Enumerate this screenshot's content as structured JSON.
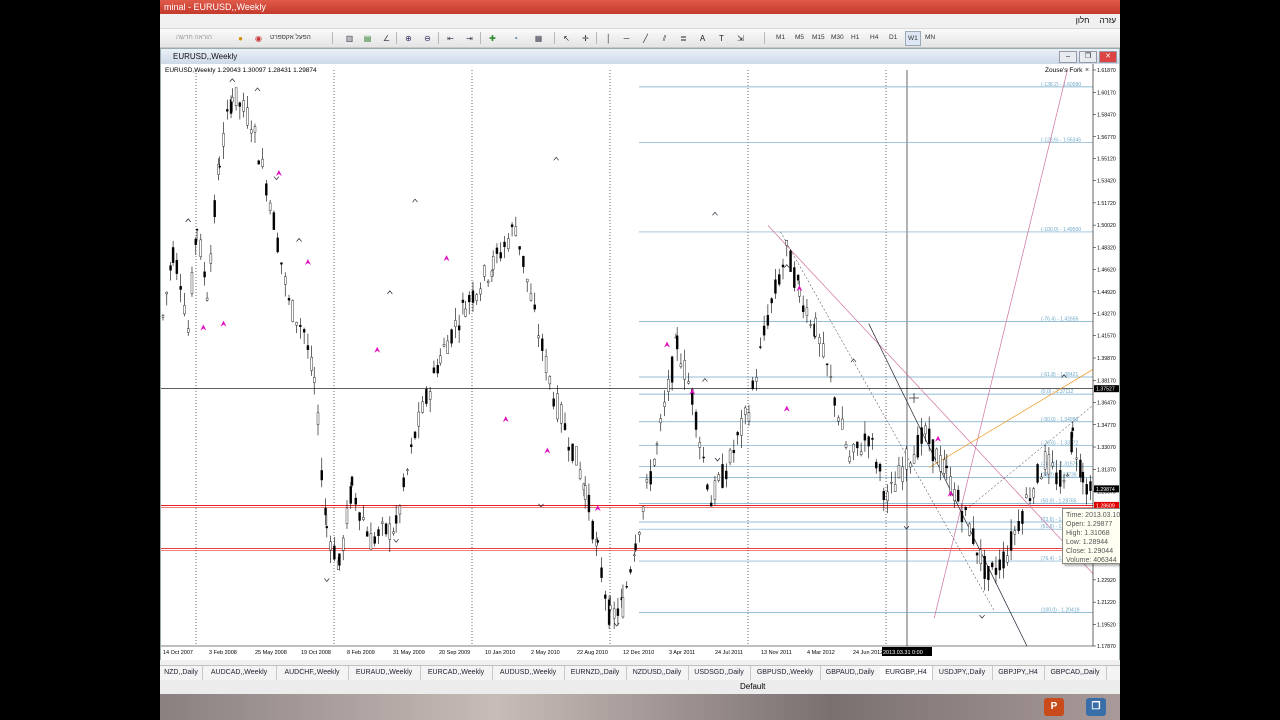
{
  "window": {
    "title": "minal - EURUSD,,Weekly"
  },
  "menu": {
    "items": [
      "עזרה",
      "חלון"
    ]
  },
  "toolbar": {
    "new_order": "הוראה חדשה",
    "expert_advisor": "הפעל אקספרט",
    "timeframes": [
      "M1",
      "M5",
      "M15",
      "M30",
      "H1",
      "H4",
      "D1",
      "W1",
      "MN"
    ],
    "active_timeframe": "W1"
  },
  "chart_window": {
    "title": "EURUSD,,Weekly"
  },
  "chart_data": {
    "type": "candlestick",
    "symbol": "EURUSD,,Weekly",
    "ohlc_header": "EURUSD,Weekly  1.29043 1.30097 1.28431 1.29874",
    "indicator_label": "Zouse's Fork",
    "y_ticks": [
      "1.61870",
      "1.60170",
      "1.58470",
      "1.56770",
      "1.55120",
      "1.53420",
      "1.51720",
      "1.50020",
      "1.48320",
      "1.46620",
      "1.44920",
      "1.43270",
      "1.41570",
      "1.39870",
      "1.38170",
      "1.36470",
      "1.34770",
      "1.33070",
      "1.31370",
      "1.29670",
      "1.28020",
      "1.26320",
      "1.24620",
      "1.22920",
      "1.21220",
      "1.19520",
      "1.17870"
    ],
    "ylim": [
      1.1787,
      1.6187
    ],
    "x_ticks": [
      "14 Oct 2007",
      "3 Feb 2008",
      "25 May 2008",
      "19 Oct 2008",
      "8 Feb 2009",
      "31 May 2009",
      "20 Sep 2009",
      "10 Jan 2010",
      "2 May 2010",
      "22 Aug 2010",
      "12 Dec 2010",
      "3 Apr 2011",
      "24 Jul 2011",
      "13 Nov 2011",
      "4 Mar 2012",
      "24 Jun 2012",
      "14 Oct 2012",
      "2013.03.31 0:00"
    ],
    "price_path": [
      [
        0,
        1.43
      ],
      [
        8,
        1.48
      ],
      [
        14,
        1.46
      ],
      [
        20,
        1.42
      ],
      [
        27,
        1.5
      ],
      [
        35,
        1.45
      ],
      [
        45,
        1.55
      ],
      [
        55,
        1.6
      ],
      [
        70,
        1.58
      ],
      [
        85,
        1.52
      ],
      [
        100,
        1.44
      ],
      [
        112,
        1.42
      ],
      [
        120,
        1.38
      ],
      [
        130,
        1.27
      ],
      [
        140,
        1.24
      ],
      [
        150,
        1.3
      ],
      [
        165,
        1.26
      ],
      [
        185,
        1.27
      ],
      [
        200,
        1.34
      ],
      [
        220,
        1.4
      ],
      [
        240,
        1.44
      ],
      [
        262,
        1.47
      ],
      [
        280,
        1.5
      ],
      [
        295,
        1.43
      ],
      [
        310,
        1.37
      ],
      [
        325,
        1.33
      ],
      [
        335,
        1.3
      ],
      [
        345,
        1.25
      ],
      [
        355,
        1.2
      ],
      [
        365,
        1.21
      ],
      [
        375,
        1.26
      ],
      [
        392,
        1.33
      ],
      [
        408,
        1.41
      ],
      [
        420,
        1.37
      ],
      [
        435,
        1.29
      ],
      [
        450,
        1.32
      ],
      [
        465,
        1.36
      ],
      [
        480,
        1.43
      ],
      [
        495,
        1.48
      ],
      [
        505,
        1.45
      ],
      [
        518,
        1.42
      ],
      [
        530,
        1.38
      ],
      [
        545,
        1.32
      ],
      [
        560,
        1.34
      ],
      [
        575,
        1.29
      ],
      [
        590,
        1.32
      ],
      [
        605,
        1.34
      ],
      [
        622,
        1.31
      ],
      [
        640,
        1.27
      ],
      [
        655,
        1.23
      ],
      [
        670,
        1.25
      ],
      [
        685,
        1.29
      ],
      [
        700,
        1.32
      ],
      [
        715,
        1.3
      ],
      [
        722,
        1.34
      ],
      [
        730,
        1.31
      ],
      [
        738,
        1.29
      ]
    ],
    "fibo_levels": [
      {
        "label": "(-138.2) - 1.60580",
        "price": 1.6058
      },
      {
        "label": "(-123.6) - 1.56345",
        "price": 1.56345
      },
      {
        "label": "(-100.0) - 1.49500",
        "price": 1.495
      },
      {
        "label": "(-76.4) - 1.42656",
        "price": 1.42656
      },
      {
        "label": "(-61.8) - 1.38421",
        "price": 1.38421
      },
      {
        "label": "(0.0) - 1.37112",
        "price": 1.37112
      },
      {
        "label": "(-50.0) - 1.34998",
        "price": 1.34998
      },
      {
        "label": "(-23.6) - 1.33172",
        "price": 1.33172
      },
      {
        "label": "(-38.2) - 1.31576",
        "price": 1.31576
      },
      {
        "label": "(38.2) - 1.30739",
        "price": 1.30739
      },
      {
        "label": "(50.0) - 1.28765",
        "price": 1.28765
      },
      {
        "label": "(23.6) - 1.27341",
        "price": 1.27341
      },
      {
        "label": "(61.8) - 1.26795",
        "price": 1.26795
      },
      {
        "label": "(76.4) - 1.24358",
        "price": 1.24358
      },
      {
        "label": "(100.0) - 1.20419",
        "price": 1.20419
      }
    ],
    "price_badges": [
      {
        "text": "1.37527",
        "price": 1.37527,
        "color": "#000000"
      },
      {
        "text": "1.29874",
        "price": 1.29874,
        "color": "#000000"
      },
      {
        "text": "1.28609",
        "price": 1.28609,
        "color": "#e00000"
      },
      {
        "text": "1.25307",
        "price": 1.25307,
        "color": "#e00000"
      }
    ],
    "red_lines": [
      1.28609,
      1.25307
    ],
    "colors": {
      "bull": "#ffffff",
      "bear": "#000000",
      "fibo": "#6fa8c8",
      "arrow": "#e010c0",
      "trend": "#f0a030",
      "fork": "#d070a0",
      "grid": "#000000"
    }
  },
  "tooltip": {
    "lines": [
      "Time: 2013.03.10 00:00",
      "Open: 1.29877",
      "High: 1.31068",
      "Low:  1.28944",
      "Close: 1.29044",
      "Volume: 406344"
    ]
  },
  "tabs": [
    "NZD,,Daily",
    "AUDCAD,,Weekly",
    "AUDCHF,,Weekly",
    "EURAUD,,Weekly",
    "EURCAD,,Weekly",
    "AUDUSD,,Weekly",
    "EURNZD,,Daily",
    "NZDUSD,,Daily",
    "USDSGD,,Daily",
    "GBPUSD,,Weekly",
    "GBPAUD,,Daily",
    "EURGBP,,H4",
    "USDJPY,,Daily",
    "GBPJPY,,H4",
    "GBPCAD,,Daily"
  ],
  "statusbar": {
    "profile": "Default"
  },
  "taskbar": {
    "icons": [
      "P",
      "❐"
    ]
  }
}
